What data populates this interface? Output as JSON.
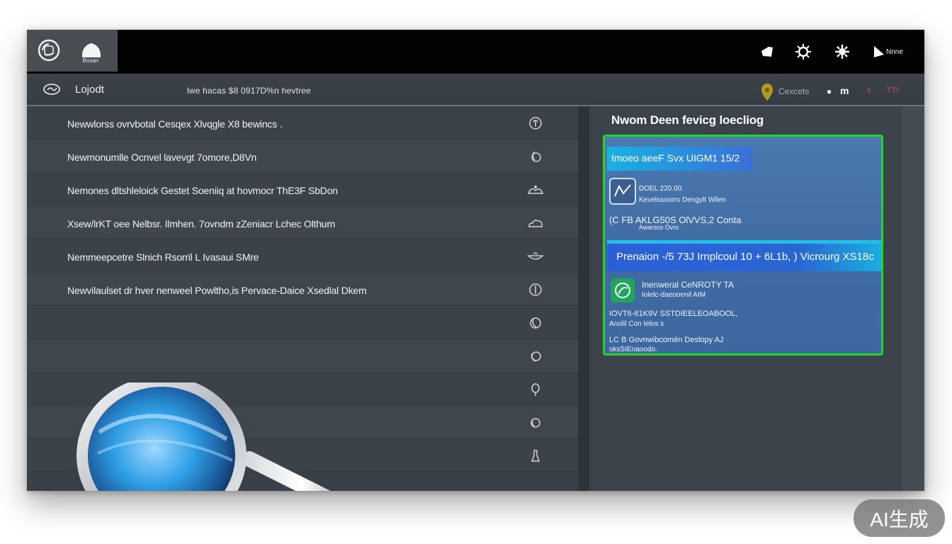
{
  "topbar": {
    "app_label": "Bosan",
    "right_label": "Nnne"
  },
  "subbar": {
    "title": "Lojodt",
    "subtitle": "lwe hacas  $8 0917D%n hevtree",
    "status_label": "Cexcets",
    "status_m": "m",
    "mark1": "s",
    "mark2": "TTI"
  },
  "list": {
    "rows": [
      {
        "label": "Newwlorss ovrvbotal Cesqex  Xlvqgle  X8 bewincs ."
      },
      {
        "label": "Newmonumlle Ocnvel lavevgt  7omore,D8Vn"
      },
      {
        "label": "Nemones dltshleloick Gestet  Soeniiq at hovmocr ThE3F SbDon"
      },
      {
        "label": "Xsew/lrKT oee  Nelbsr. Ilmhen.  7ovndm  zZeniacr Lchec  Olthum"
      },
      {
        "label": "Nemmeepcetre Slnich Rsorril L  Ivasaui SMre"
      },
      {
        "label": "Newvilaulset dr hver nenweel Powltho,is Pervace-Daice  Xsedlal Dkem"
      }
    ],
    "extra_glyph_count": 6
  },
  "right": {
    "title": "Nwom Deen fevicg  loecliog",
    "card": {
      "head": "Imoeo aeeF Svx  UIGM1 15/2",
      "item1_line1": "DOEL 220.00.",
      "item1_line2": "Kevelssoorro Dengylt Wlien",
      "line3": "(C FB  AKLG50S OlVVS,2 Conta",
      "line3b": "Awarsco Ovro",
      "banner": "Prenaion -/5 73J  Irnplcoul  10 + 6L1b,  ) Vicrourg XS18c",
      "item2_line1": "Inenweral  CeNROTY TA",
      "item2_line2": "Iolelc-daeooenil AIM",
      "line6": "IOVT6-61K9V  SSTDIEELEOABOOL,",
      "line7": "Anolil  Con  Ielos  s",
      "line8": "LC B Govnwibcomén  Deslopy AJ",
      "line9": "oksSIEnaoodo."
    }
  },
  "badge": "AI生成",
  "colors": {
    "accent_green": "#22d32b",
    "card_blue": "#4c79b0",
    "banner_blue": "#2b5fd8"
  }
}
